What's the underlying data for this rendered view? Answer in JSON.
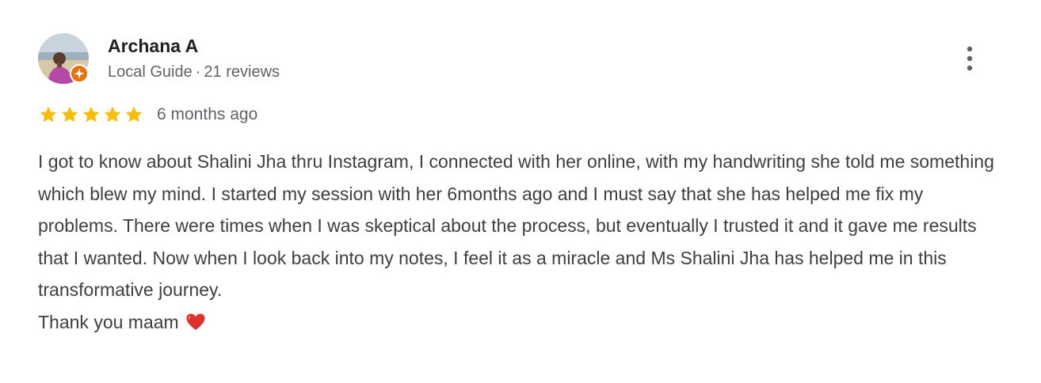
{
  "review": {
    "author": {
      "name": "Archana A",
      "badge": "Local Guide",
      "separator": "·",
      "reviews_count": "21 reviews",
      "avatar_icon": "user-avatar-photo",
      "badge_icon": "local-guide-star-icon"
    },
    "rating": {
      "stars": 5,
      "max_stars": 5,
      "star_color": "#fbbc04",
      "date": "6 months ago"
    },
    "body": "I got to know about Shalini Jha thru Instagram, I connected with her online, with my handwriting she told me something which blew my mind. I started my session with her 6months ago and I must say that she has helped me fix my problems. There were times when I was skeptical about the process, but eventually I trusted it and it gave me results that I wanted. Now when I look back into my notes, I feel it as a miracle and Ms Shalini Jha has helped me in this transformative journey.",
    "closing": "Thank you maam",
    "closing_emoji_icon": "red-heart-icon",
    "menu_icon": "more-vert-icon",
    "accent_color": "#e8710a"
  }
}
